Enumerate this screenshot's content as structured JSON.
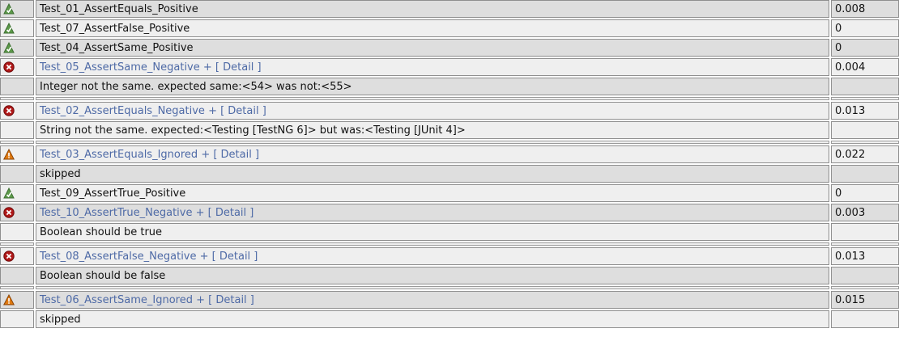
{
  "colors": {
    "pass_icon": "#5d9a4a",
    "fail_icon": "#b01818",
    "skip_icon": "#e07a10",
    "link": "#4e6aa6",
    "row_dark": "#dedede",
    "row_light": "#efefef"
  },
  "rows": [
    {
      "status": "pass-icon",
      "name": "Test_01_AssertEquals_Positive",
      "time": "0.008"
    },
    {
      "status": "pass-icon",
      "name": "Test_07_AssertFalse_Positive",
      "time": "0"
    },
    {
      "status": "pass-icon",
      "name": "Test_04_AssertSame_Positive",
      "time": "0"
    },
    {
      "status": "fail-icon",
      "name": "Test_05_AssertSame_Negative",
      "detail": "+ [ Detail ]",
      "time": "0.004",
      "message": "Integer not the same. expected same:<54> was not:<55>"
    },
    {
      "status": "fail-icon",
      "name": "Test_02_AssertEquals_Negative",
      "detail": "+ [ Detail ]",
      "time": "0.013",
      "message": "String not the same. expected:<Testing [TestNG 6]> but was:<Testing [JUnit 4]>"
    },
    {
      "status": "skip-icon",
      "name": "Test_03_AssertEquals_Ignored",
      "detail": "+ [ Detail ]",
      "time": "0.022",
      "message": "skipped"
    },
    {
      "status": "pass-icon",
      "name": "Test_09_AssertTrue_Positive",
      "time": "0"
    },
    {
      "status": "fail-icon",
      "name": "Test_10_AssertTrue_Negative",
      "detail": "+ [ Detail ]",
      "time": "0.003",
      "message": "Boolean should be true"
    },
    {
      "status": "fail-icon",
      "name": "Test_08_AssertFalse_Negative",
      "detail": "+ [ Detail ]",
      "time": "0.013",
      "message": "Boolean should be false"
    },
    {
      "status": "skip-icon",
      "name": "Test_06_AssertSame_Ignored",
      "detail": "+ [ Detail ]",
      "time": "0.015",
      "message": "skipped"
    }
  ]
}
